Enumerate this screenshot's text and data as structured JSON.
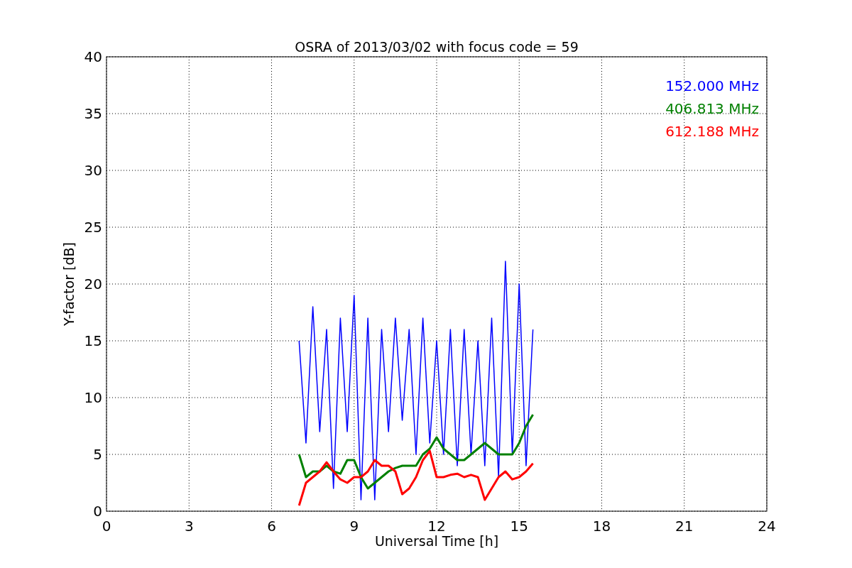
{
  "figure": {
    "chart_data": {
      "type": "line",
      "title": "OSRA of 2013/03/02 with focus code = 59",
      "xlabel": "Universal Time [h]",
      "ylabel": "Y-factor [dB]",
      "x": [
        7,
        7.25,
        7.5,
        7.75,
        8,
        8.25,
        8.5,
        8.75,
        9,
        9.25,
        9.5,
        9.75,
        10,
        10.25,
        10.5,
        10.75,
        11,
        11.25,
        11.5,
        11.75,
        12,
        12.25,
        12.5,
        12.75,
        13,
        13.25,
        13.5,
        13.75,
        14,
        14.25,
        14.5,
        14.75,
        15,
        15.25,
        15.5
      ],
      "series": [
        {
          "name": "152.000 MHz",
          "color": "#0000ff",
          "values": [
            15,
            6,
            18,
            7,
            16,
            2,
            17,
            7,
            19,
            1,
            17,
            1,
            16,
            7,
            17,
            8,
            16,
            5,
            17,
            6,
            15,
            5,
            16,
            4,
            16,
            5,
            15,
            4,
            17,
            3,
            22,
            5,
            20,
            4,
            16
          ]
        },
        {
          "name": "406.813 MHz",
          "color": "#008000",
          "values": [
            5,
            3,
            3.5,
            3.5,
            4,
            3.5,
            3.3,
            4.5,
            4.5,
            3,
            2,
            2.5,
            3,
            3.5,
            3.8,
            4,
            4,
            4,
            5,
            5.5,
            6.5,
            5.5,
            5,
            4.5,
            4.5,
            5,
            5.5,
            6,
            5.5,
            5,
            5,
            5,
            6,
            7.5,
            8.5
          ]
        },
        {
          "name": "612.188 MHz",
          "color": "#ff0000",
          "values": [
            0.5,
            2.5,
            3,
            3.5,
            4.3,
            3.5,
            2.8,
            2.5,
            3,
            3,
            3.5,
            4.5,
            4,
            4,
            3.5,
            1.5,
            2,
            3,
            4.5,
            5.3,
            3,
            3,
            3.2,
            3.3,
            3,
            3.2,
            3,
            1,
            2,
            3,
            3.5,
            2.8,
            3,
            3.5,
            4.2
          ]
        }
      ],
      "grid": true,
      "xlim": [
        0,
        24
      ],
      "ylim": [
        0,
        40
      ],
      "xticks": [
        0,
        3,
        6,
        9,
        12,
        15,
        18,
        21,
        24
      ],
      "yticks": [
        0,
        5,
        10,
        15,
        20,
        25,
        30,
        35,
        40
      ]
    }
  }
}
